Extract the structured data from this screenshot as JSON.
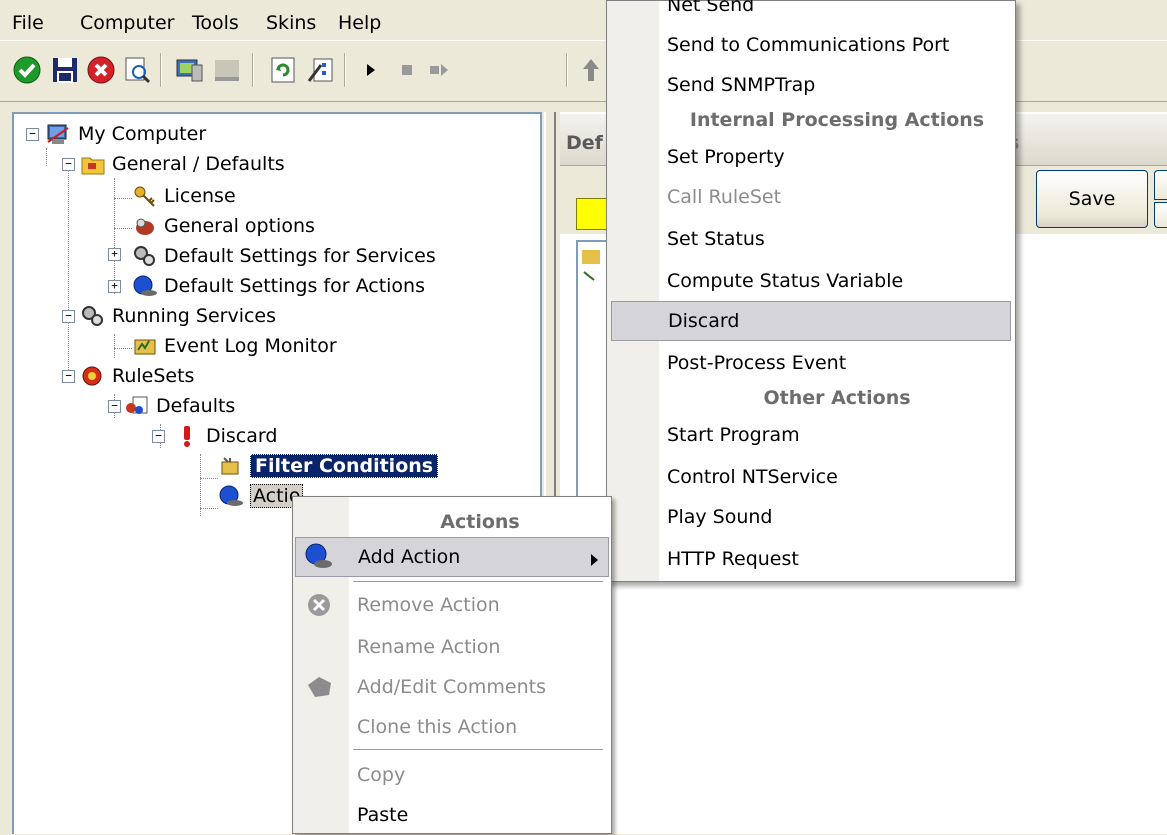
{
  "menubar": {
    "items": [
      "File",
      "Computer",
      "Tools",
      "Skins",
      "Help"
    ]
  },
  "toolbar": {
    "buttons": [
      "ok-icon",
      "save-icon",
      "cancel-icon",
      "search-icon",
      "monitor-icon",
      "stop-square-icon",
      "refresh-icon",
      "wizard-icon",
      "play-icon",
      "stop-icon",
      "step-icon",
      "up-arrow-icon"
    ]
  },
  "tree": {
    "root": "My Computer",
    "general_defaults": "General / Defaults",
    "license": "License",
    "general_options": "General options",
    "default_settings_services": "Default Settings for Services",
    "default_settings_actions": "Default Settings for Actions",
    "running_services": "Running Services",
    "event_log_monitor": "Event Log Monitor",
    "rulesets": "RuleSets",
    "defaults": "Defaults",
    "discard": "Discard",
    "filter_conditions": "Filter Conditions",
    "actions": "Actio"
  },
  "right_panel": {
    "title_fragment": "Def",
    "title_fragment_right": "s",
    "save_label": "Save"
  },
  "context_menu": {
    "header": "Actions",
    "add_action": "Add Action",
    "remove_action": "Remove Action",
    "rename_action": "Rename Action",
    "add_edit_comments": "Add/Edit Comments",
    "clone_action": "Clone this Action",
    "copy": "Copy",
    "paste": "Paste"
  },
  "submenu": {
    "cut_item": "Net Send",
    "send_comm_port": "Send to Communications Port",
    "send_snmp_trap": "Send SNMPTrap",
    "header_internal": "Internal Processing Actions",
    "set_property": "Set Property",
    "call_ruleset": "Call RuleSet",
    "set_status": "Set Status",
    "compute_status_variable": "Compute Status Variable",
    "discard": "Discard",
    "post_process_event": "Post-Process Event",
    "header_other": "Other Actions",
    "start_program": "Start Program",
    "control_ntservice": "Control NTService",
    "play_sound": "Play Sound",
    "http_request": "HTTP Request"
  },
  "colors": {
    "selection": "#0a246a",
    "menu_highlight": "#d5d5d9",
    "disabled_text": "#8c8c8c",
    "window_bg": "#ece9d8"
  }
}
